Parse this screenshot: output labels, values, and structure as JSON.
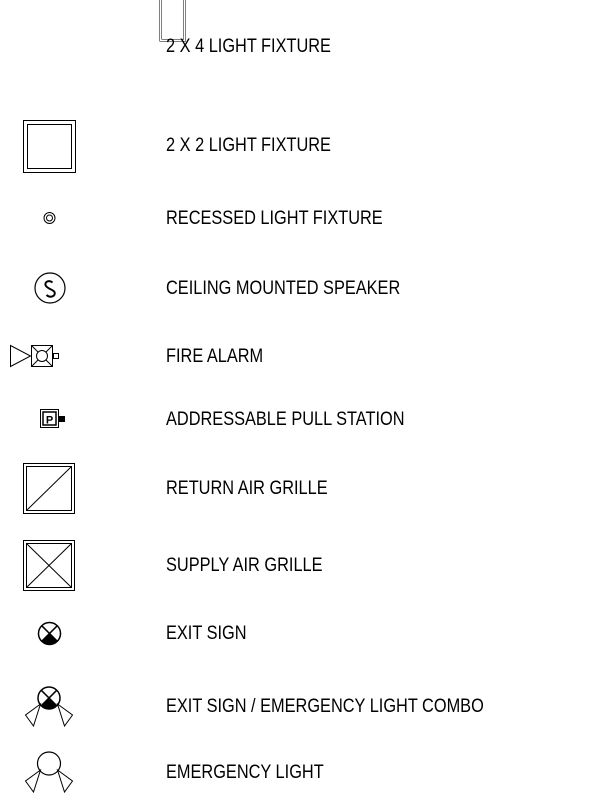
{
  "legend": {
    "items": [
      {
        "symbol": "2x4-light-fixture-icon",
        "label": "2 X 4 LIGHT FIXTURE"
      },
      {
        "symbol": "2x2-light-fixture-icon",
        "label": "2 X 2 LIGHT FIXTURE"
      },
      {
        "symbol": "recessed-light-icon",
        "label": "RECESSED LIGHT FIXTURE"
      },
      {
        "symbol": "speaker-icon",
        "label": "CEILING MOUNTED SPEAKER"
      },
      {
        "symbol": "fire-alarm-icon",
        "label": "FIRE ALARM"
      },
      {
        "symbol": "pull-station-icon",
        "label": "ADDRESSABLE PULL STATION"
      },
      {
        "symbol": "return-air-grille-icon",
        "label": "RETURN AIR GRILLE"
      },
      {
        "symbol": "supply-air-grille-icon",
        "label": "SUPPLY AIR GRILLE"
      },
      {
        "symbol": "exit-sign-icon",
        "label": "EXIT SIGN"
      },
      {
        "symbol": "exit-emergency-combo-icon",
        "label": "EXIT SIGN / EMERGENCY LIGHT COMBO"
      },
      {
        "symbol": "emergency-light-icon",
        "label": "EMERGENCY LIGHT"
      }
    ],
    "pull_station_letter": "P",
    "stroke_color": "#000000"
  }
}
